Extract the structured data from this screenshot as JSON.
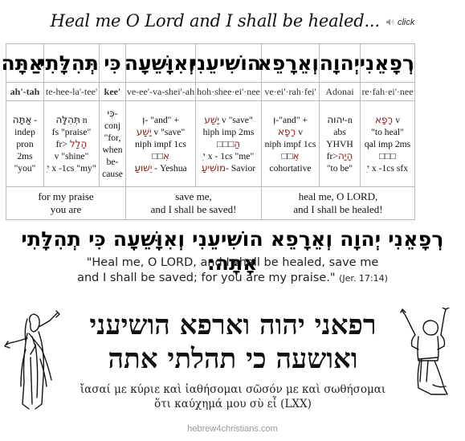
{
  "header": {
    "title": "Heal me O Lord and I shall be healed...",
    "audio_label": "click",
    "audio_icon": "speaker-icon"
  },
  "columns": [
    {
      "hebrew": "אַתָּה",
      "transliteration": "ah'-tah",
      "gloss": [
        {
          "heb": "אַתָּה",
          "text": " - "
        },
        {
          "text": "indep"
        },
        {
          "text": "pron"
        },
        {
          "text": "2ms"
        },
        {
          "text": "\"you\""
        }
      ]
    },
    {
      "hebrew": "תְּהִלָּתִי",
      "transliteration": "te-hee-la'-tee'",
      "gloss": [
        {
          "heb": "תְּהִלָּה",
          "text": " n"
        },
        {
          "text": "fs \"praise\""
        },
        {
          "text": "fr> ",
          "heb_red": "הָלַל"
        },
        {
          "text": "v \"shine\""
        },
        {
          "text": "ִי x -1cs \"my\""
        }
      ]
    },
    {
      "hebrew": "כִּי",
      "transliteration": "kee'",
      "gloss": [
        {
          "heb": "כִּי",
          "text": "-"
        },
        {
          "text": "conj"
        },
        {
          "text": "\"for,"
        },
        {
          "text": "when"
        },
        {
          "text": "be-"
        },
        {
          "text": "cause"
        }
      ]
    },
    {
      "hebrew": "וְאִוָּשֵׁעָה",
      "transliteration": "ve-ee'-va-shei'-ah",
      "gloss": [
        {
          "heb": "וְ",
          "text": "- \"and\" +"
        },
        {
          "heb_red": "יָשַׁע",
          "text": "  v \"save\""
        },
        {
          "text": "niph impf 1cs"
        },
        {
          "text": "□□",
          "heb_red": "אִ"
        },
        {
          "heb_red": "יֵשׁוּעַ",
          "text": " - Yeshua"
        }
      ]
    },
    {
      "hebrew": "הוֹשִׁיעֵנִי",
      "transliteration": "hoh·shee·ei'·nee",
      "gloss": [
        {
          "heb_red": "יָשַׁע",
          "text": "  v \"save\""
        },
        {
          "text": "hiph imp 2ms"
        },
        {
          "text": "□□□",
          "heb_red": "הַ"
        },
        {
          "text": "ִי x - 1cs \"me\""
        },
        {
          "heb_red": "מוֹשִׁיעַ",
          "text": "- Savior"
        }
      ]
    },
    {
      "hebrew": "וְאֵרָפֵא",
      "transliteration": "ve·ei'·rah·fei'",
      "gloss": [
        {
          "heb": "וְ",
          "text": "-\"and\" +"
        },
        {
          "heb_red": "רָפָא",
          "text": "  v"
        },
        {
          "text": "niph impf 1cs"
        },
        {
          "text": "□□",
          "heb_red": "אֵ"
        },
        {
          "text": "cohortative"
        }
      ]
    },
    {
      "hebrew": "יְהוָה",
      "transliteration": "Adonai",
      "gloss": [
        {
          "heb": "יהוה",
          "text": "-n"
        },
        {
          "text": "abs"
        },
        {
          "text": "YHVH"
        },
        {
          "text": "fr>",
          "heb_red": "הָיָה"
        },
        {
          "text": "\"to be\""
        }
      ]
    },
    {
      "hebrew": "רְפָאֵנִי",
      "transliteration": "re·fah·ei'·nee",
      "gloss": [
        {
          "heb_red": "רָפָא",
          "text": "  v"
        },
        {
          "text": "\"to heal\""
        },
        {
          "text": "qal imp 2ms"
        },
        {
          "text": "□□□"
        },
        {
          "text": "ִי x -1cs sfx"
        }
      ]
    }
  ],
  "translations": [
    {
      "lines": [
        "for my praise",
        "you are"
      ]
    },
    {
      "lines": [
        "save me,",
        "and I shall be saved!"
      ]
    },
    {
      "lines": [
        "heal me, O LORD,",
        "and I shall be healed!"
      ]
    }
  ],
  "full_verse_hebrew": "רְפָאֵנִי יְהוָה וְאֵרָפֵא הוֹשִׁיעֵנִי וְאִוָּשֵׁעָה כִּי תְהִלָּתִי אָתָּה׃",
  "english": {
    "line1": "\"Heal me, O LORD, and I shall be healed, save me",
    "line2": "and I shall be saved; for you are my praise.\"",
    "reference": "(Jer. 17:14)"
  },
  "hebrew_display": {
    "line1": "רפאני יהוה וארפא הושיעני",
    "line2": "ואושעה כי תהלתי אתה"
  },
  "greek": {
    "line1": "ἴασαί με κύριε καὶ ἰαθήσομαι σῶσόν με καὶ σωθήσομαι",
    "line2": "ὅτι καύχημά μου σὺ εἶ",
    "source": "(LXX)"
  },
  "footer": {
    "site": "hebrew4christians.com"
  },
  "illustrations": {
    "left": "praying-man-arms-raised-icon",
    "right": "kneeling-man-arms-raised-icon"
  }
}
